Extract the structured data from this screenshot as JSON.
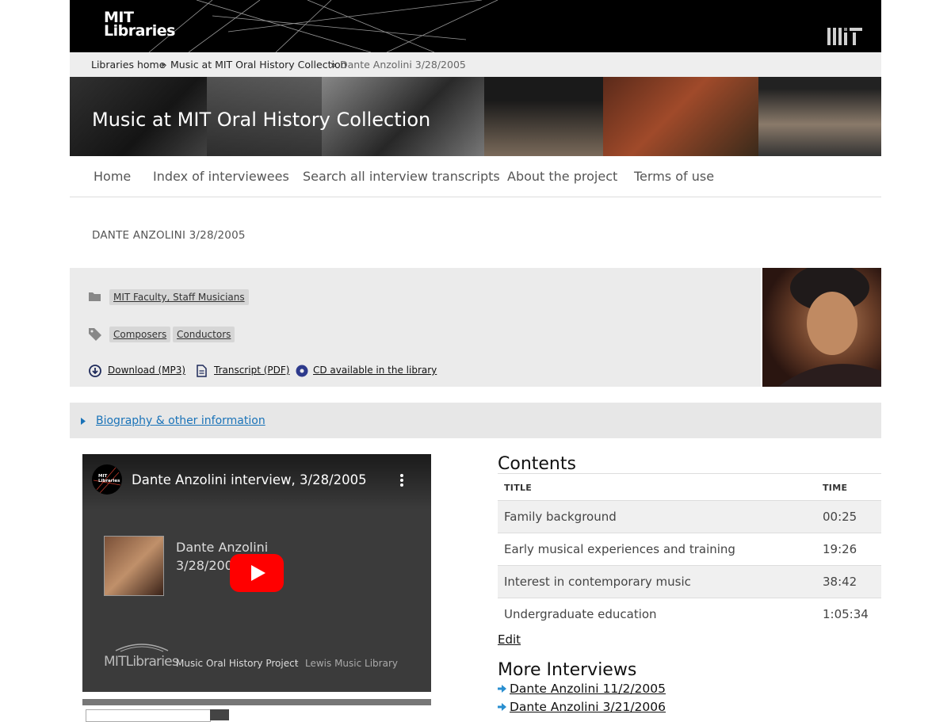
{
  "header": {
    "logo_line1": "MIT",
    "logo_line2": "Libraries"
  },
  "breadcrumb": {
    "items": [
      "Libraries home",
      "Music at MIT Oral History Collection"
    ],
    "separator": "»",
    "current": "Dante Anzolini 3/28/2005"
  },
  "banner": {
    "title": "Music at MIT Oral History Collection"
  },
  "nav": {
    "items": [
      "Home",
      "Index of interviewees",
      "Search all interview transcripts",
      "About the project",
      "Terms of use"
    ]
  },
  "page": {
    "title": "DANTE ANZOLINI 3/28/2005"
  },
  "meta": {
    "category": "MIT Faculty, Staff Musicians",
    "tags": [
      "Composers",
      "Conductors"
    ],
    "downloads": {
      "mp3": "Download (MP3)",
      "pdf": "Transcript (PDF)",
      "cd": "CD available in the library"
    }
  },
  "biography": {
    "label": "Biography & other information"
  },
  "video": {
    "title": "Dante Anzolini interview, 3/28/2005",
    "channel_logo_line1": "MIT",
    "channel_logo_line2": "Libraries",
    "card_name": "Dante Anzolini",
    "card_date": "3/28/2005",
    "footer_brand": "MITLibraries",
    "footer_project": "Music Oral History Project",
    "footer_dot": "·",
    "footer_library": "Lewis Music Library"
  },
  "contents": {
    "heading": "Contents",
    "col_title": "TITLE",
    "col_time": "TIME",
    "rows": [
      {
        "title": "Family background",
        "time": "00:25"
      },
      {
        "title": "Early musical experiences and training",
        "time": "19:26"
      },
      {
        "title": "Interest in contemporary music",
        "time": "38:42"
      },
      {
        "title": "Undergraduate education",
        "time": "1:05:34"
      }
    ],
    "edit_label": "Edit"
  },
  "more": {
    "heading": "More Interviews",
    "items": [
      "Dante Anzolini 11/2/2005",
      "Dante Anzolini 3/21/2006"
    ]
  },
  "colors": {
    "link_blue": "#1a73b8",
    "youtube_red": "#ff0000",
    "header_black": "#000000"
  }
}
